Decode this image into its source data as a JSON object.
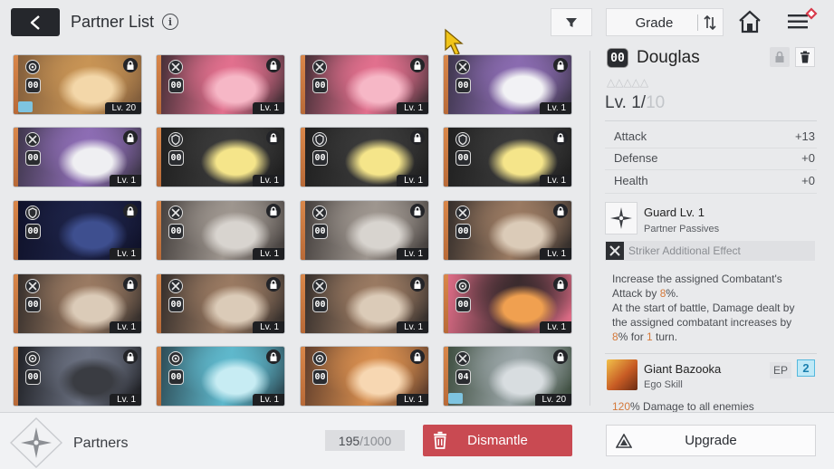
{
  "header": {
    "title": "Partner List",
    "info_icon": "i",
    "sort_label": "Grade",
    "icons": [
      "back-arrow-icon",
      "info-icon",
      "filter-icon",
      "sort-order-icon",
      "home-icon",
      "menu-icon"
    ]
  },
  "cards": [
    {
      "grade": "00",
      "level": "Lv. 20",
      "class_icon": "gear-icon",
      "equip": true,
      "palette": [
        "#f3d7a9",
        "#c89455",
        "#7d5a3a"
      ]
    },
    {
      "grade": "00",
      "level": "Lv. 1",
      "class_icon": "crossed-swords-icon",
      "equip": false,
      "palette": [
        "#f6b7c6",
        "#e2708e",
        "#3d2c32"
      ]
    },
    {
      "grade": "00",
      "level": "Lv. 1",
      "class_icon": "crossed-swords-icon",
      "equip": false,
      "palette": [
        "#f6b7c6",
        "#e2708e",
        "#3d2c32"
      ]
    },
    {
      "grade": "00",
      "level": "Lv. 1",
      "class_icon": "crossed-swords-icon",
      "equip": false,
      "palette": [
        "#f2f2f5",
        "#8a6bb0",
        "#3a3347"
      ]
    },
    {
      "grade": "00",
      "level": "Lv. 1",
      "class_icon": "crossed-swords-icon",
      "equip": false,
      "palette": [
        "#efeff2",
        "#8d6db4",
        "#3b3446"
      ]
    },
    {
      "grade": "00",
      "level": "Lv. 1",
      "class_icon": "shield-icon",
      "equip": false,
      "palette": [
        "#f5e58a",
        "#3a3a3a",
        "#1e1e1e"
      ]
    },
    {
      "grade": "00",
      "level": "Lv. 1",
      "class_icon": "shield-icon",
      "equip": false,
      "palette": [
        "#f5e58a",
        "#3a3a3a",
        "#1e1e1e"
      ]
    },
    {
      "grade": "00",
      "level": "Lv. 1",
      "class_icon": "shield-icon",
      "equip": false,
      "palette": [
        "#f5e58a",
        "#3a3a3a",
        "#1e1e1e"
      ]
    },
    {
      "grade": "00",
      "level": "Lv. 1",
      "class_icon": "shield-icon",
      "equip": false,
      "palette": [
        "#3e4f8f",
        "#1d2348",
        "#0f1128"
      ]
    },
    {
      "grade": "00",
      "level": "Lv. 1",
      "class_icon": "crossed-swords-icon",
      "equip": false,
      "palette": [
        "#d8d4cf",
        "#9e968f",
        "#403b39"
      ]
    },
    {
      "grade": "00",
      "level": "Lv. 1",
      "class_icon": "crossed-swords-icon",
      "equip": false,
      "palette": [
        "#d8d4cf",
        "#9e968f",
        "#403b39"
      ]
    },
    {
      "grade": "00",
      "level": "Lv. 1",
      "class_icon": "crossed-swords-icon",
      "equip": false,
      "palette": [
        "#dbcbb8",
        "#9a7a62",
        "#2f2a28"
      ]
    },
    {
      "grade": "00",
      "level": "Lv. 1",
      "class_icon": "crossed-swords-icon",
      "equip": false,
      "palette": [
        "#dbcbb8",
        "#9a7a62",
        "#2f2a28"
      ]
    },
    {
      "grade": "00",
      "level": "Lv. 1",
      "class_icon": "crossed-swords-icon",
      "equip": false,
      "palette": [
        "#dbcbb8",
        "#9a7a62",
        "#2f2a28"
      ]
    },
    {
      "grade": "00",
      "level": "Lv. 1",
      "class_icon": "crossed-swords-icon",
      "equip": false,
      "palette": [
        "#dbcbb8",
        "#9a7a62",
        "#2f2a28"
      ]
    },
    {
      "grade": "00",
      "level": "Lv. 1",
      "class_icon": "gear-icon",
      "equip": false,
      "palette": [
        "#f0a050",
        "#3b2b2e",
        "#e8708c"
      ]
    },
    {
      "grade": "00",
      "level": "Lv. 1",
      "class_icon": "gear-icon",
      "equip": false,
      "palette": [
        "#3a3c42",
        "#6a7080",
        "#1c1d21"
      ]
    },
    {
      "grade": "00",
      "level": "Lv. 1",
      "class_icon": "gear-icon",
      "equip": false,
      "palette": [
        "#c7ecf3",
        "#5fb8cc",
        "#2b4650"
      ]
    },
    {
      "grade": "00",
      "level": "Lv. 1",
      "class_icon": "gear-icon",
      "equip": false,
      "palette": [
        "#f7d7b2",
        "#d78e4f",
        "#5a3a2a"
      ]
    },
    {
      "grade": "04",
      "level": "Lv. 20",
      "class_icon": "crossed-swords-icon",
      "equip": true,
      "palette": [
        "#d8dde0",
        "#9aa5a7",
        "#3a4a3b"
      ]
    }
  ],
  "detail": {
    "grade": "00",
    "name": "Douglas",
    "stars": "△△△△△",
    "level_prefix": "Lv. 1/",
    "level_max": "10",
    "stats": [
      {
        "label": "Attack",
        "value": "+13"
      },
      {
        "label": "Defense",
        "value": "+0"
      },
      {
        "label": "Health",
        "value": "+0"
      }
    ],
    "passive": {
      "name": "Guard Lv. 1",
      "type": "Partner Passives"
    },
    "additional_effect": "Striker Additional Effect",
    "desc": {
      "l1": "Increase the assigned Combatant's",
      "l2a": "Attack by ",
      "l2b": "8",
      "l2c": "%.",
      "l3": "At the start of battle, Damage dealt by",
      "l4": "the assigned combatant increases by",
      "l5a": "8",
      "l5b": "% for ",
      "l5c": "1",
      "l5d": " turn."
    },
    "ego": {
      "name": "Giant Bazooka",
      "type": "Ego Skill",
      "ep_label": "EP",
      "ep_value": "2",
      "desc_prefix": "120",
      "desc_rest": "% Damage to all enemies"
    }
  },
  "footer": {
    "label": "Partners",
    "count": "195",
    "count_sep": " / ",
    "count_max": "1000",
    "dismantle_label": "Dismantle",
    "upgrade_label": "Upgrade"
  },
  "colors": {
    "accent_red": "#c94a52",
    "highlight_orange": "#d4793b",
    "ep_blue": "#54b8de"
  }
}
